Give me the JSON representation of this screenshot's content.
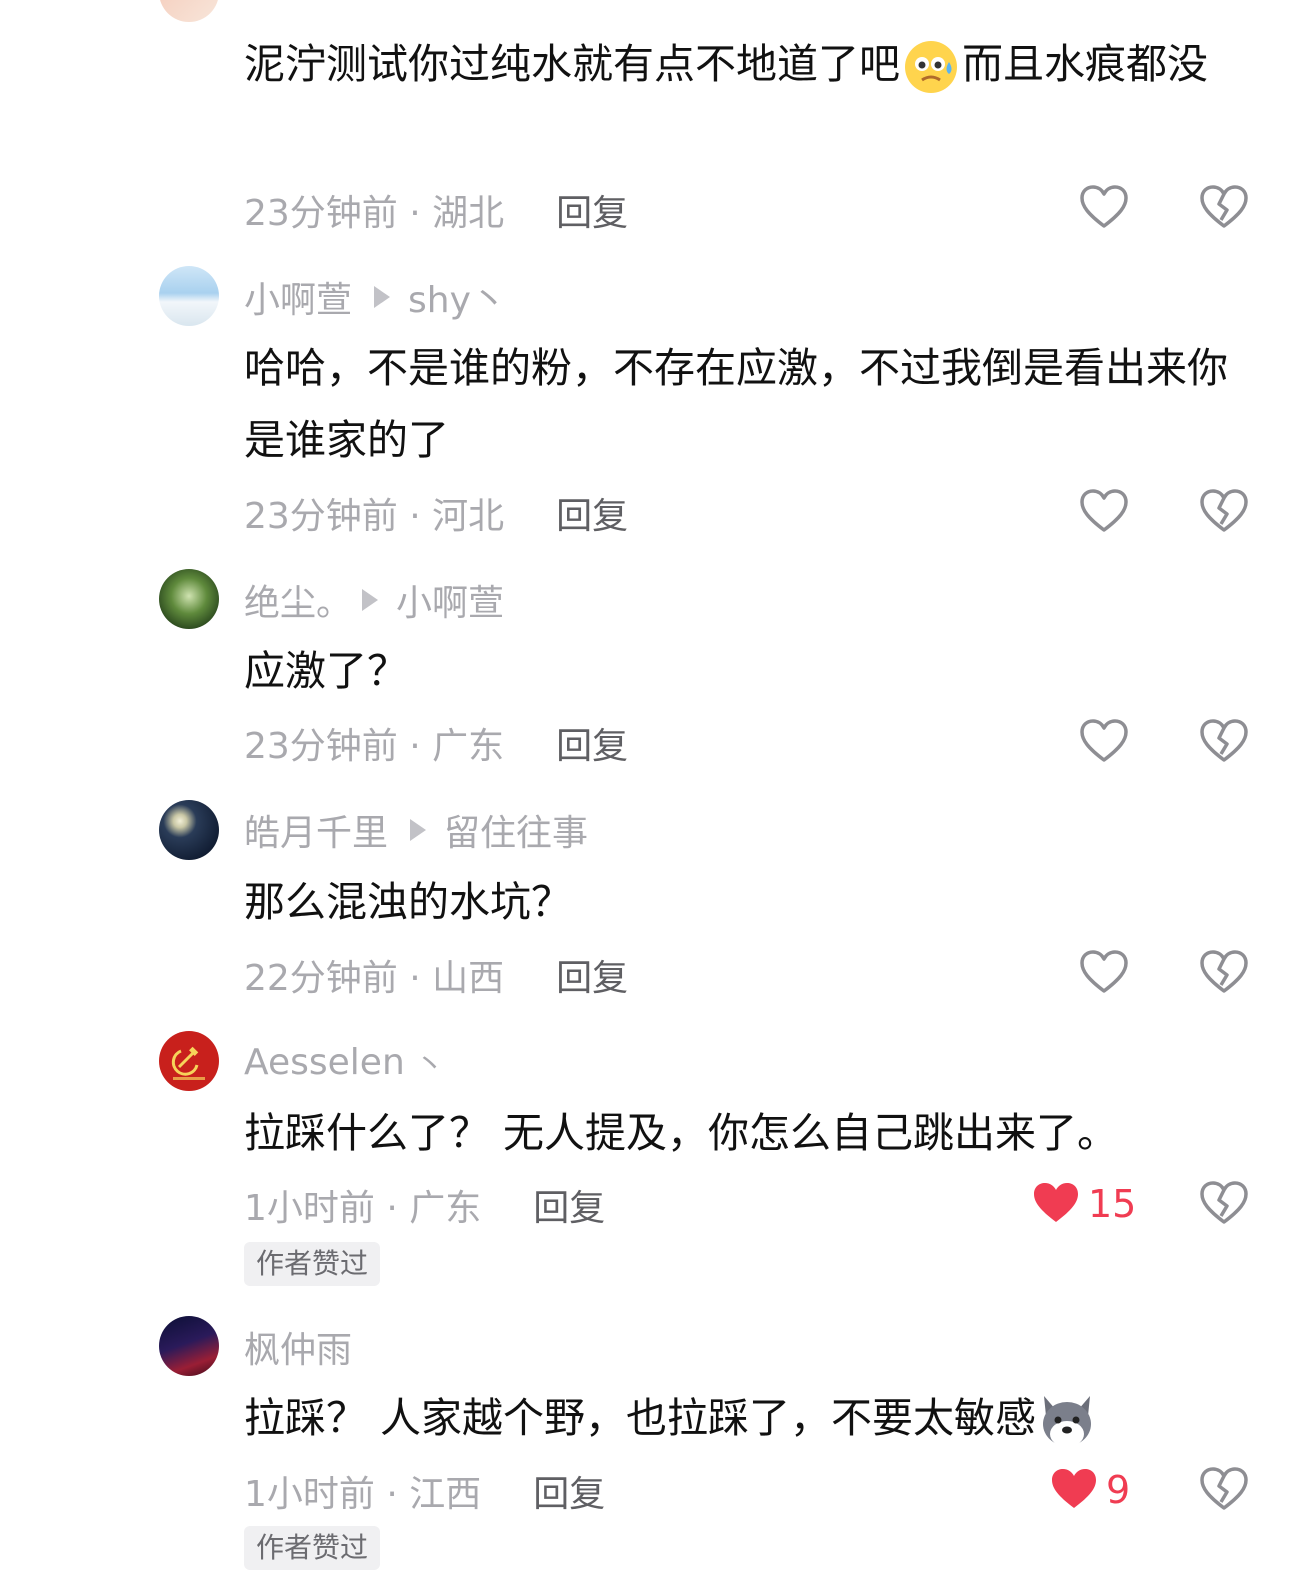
{
  "comments": [
    {
      "body": "泥泞测试你过纯水就有点不地道了吧",
      "body_tail": "而且水痕都没",
      "body_emoji": "sweat-smile-emoji",
      "time_loc": "23分钟前 · 湖北",
      "reply": "回复"
    },
    {
      "author": "小啊萱",
      "target": "shy丶",
      "body": "哈哈，不是谁的粉，不存在应激，不过我倒是看出来你是谁家的了",
      "time_loc": "23分钟前 · 河北",
      "reply": "回复"
    },
    {
      "author": "绝尘。",
      "target": "小啊萱",
      "body": "应激了？",
      "time_loc": "23分钟前 · 广东",
      "reply": "回复"
    },
    {
      "author": "皓月千里",
      "target": "留住往事",
      "body": "那么混浊的水坑？",
      "time_loc": "22分钟前 · 山西",
      "reply": "回复"
    },
    {
      "author": "Aesselen",
      "author_suffix": "丶",
      "body": "拉踩什么了？ 无人提及，你怎么自己跳出来了。",
      "time_loc": "1小时前 · 广东",
      "reply": "回复",
      "likes": "15",
      "badge": "作者赞过"
    },
    {
      "author": "枫仲雨",
      "body": "拉踩？  人家越个野，也拉踩了，不要太敏感",
      "body_emoji": "doge-wolf-emoji",
      "time_loc": "1小时前 · 江西",
      "reply": "回复",
      "likes": "9",
      "badge": "作者赞过"
    }
  ],
  "colors": {
    "like_active": "#f03c52",
    "secondary_text": "#a9a9ae",
    "primary_text": "#111111"
  }
}
